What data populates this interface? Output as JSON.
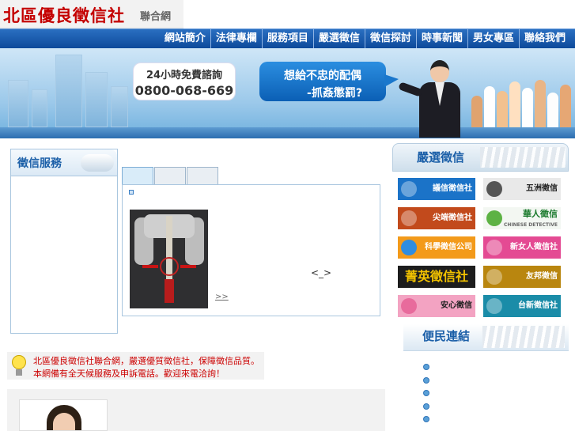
{
  "logo": {
    "main": "北區優良徵信社",
    "sub": "聯合網"
  },
  "nav": [
    "網站簡介",
    "法律專欄",
    "服務項目",
    "嚴選徵信",
    "徵信探討",
    "時事新聞",
    "男女專區",
    "聯絡我們"
  ],
  "banner": {
    "hotline_label": "24小時免費諮詢",
    "hotline_number": "0800-068-669",
    "quote_line1": "想給不忠的配偶",
    "quote_line2": "-抓姦懲罰?"
  },
  "left": {
    "title": "徵信服務"
  },
  "content": {
    "center_text": "<_>",
    "more": ">>"
  },
  "right": {
    "title": "嚴選徵信",
    "agencies": [
      {
        "name": "議信徵信社",
        "color": "#1b73c8"
      },
      {
        "name": "五洲徵信",
        "color": "#e9e9e9"
      },
      {
        "name": "尖端徵信社",
        "color": "#c24a1c"
      },
      {
        "name": "華人徵信",
        "color": "#f3f7f2"
      },
      {
        "name": "科學徵信公司",
        "color": "#f39a1a"
      },
      {
        "name": "新女人徵信社",
        "color": "#e44a93"
      },
      {
        "name": "菁英徵信社",
        "color": "#1d1d1d"
      },
      {
        "name": "友邦徵信",
        "color": "#b9860f"
      },
      {
        "name": "安心徵信",
        "color": "#f3a3c2"
      },
      {
        "name": "台新徵信社",
        "color": "#1a8ca8"
      }
    ],
    "agency_extra": {
      "chinese_detective": "CHINESE DETECTIVE"
    }
  },
  "convenience": {
    "title": "便民連結"
  },
  "notice": {
    "line1": "北區優良徵信社聯合網，嚴選優質徵信社，保障徵信品質。",
    "line2": "本網備有全天候服務及申訴電話。歡迎來電洽詢！"
  }
}
